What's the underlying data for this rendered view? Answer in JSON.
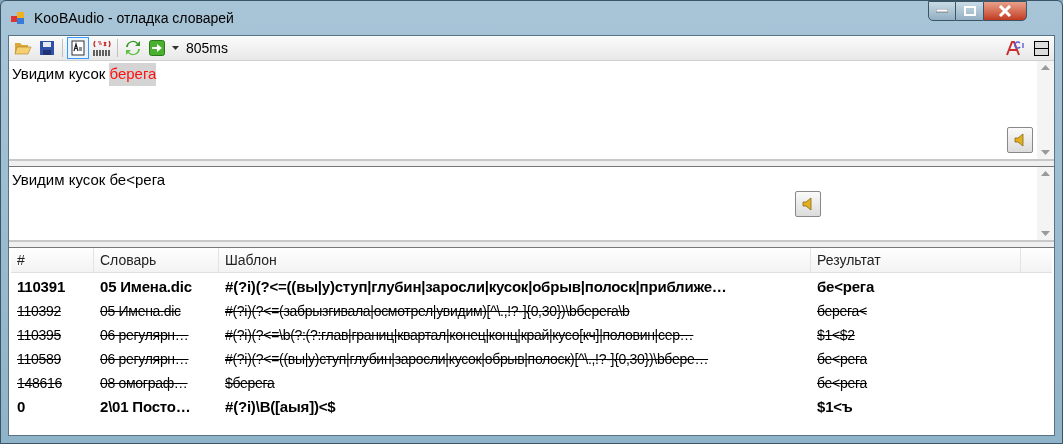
{
  "window": {
    "title": "KooBAudio - отладка словарей"
  },
  "toolbar": {
    "buttons": [
      {
        "kind": "open",
        "selected": false
      },
      {
        "kind": "save",
        "selected": false
      },
      {
        "kind": "text-mode",
        "selected": true
      },
      {
        "kind": "regex",
        "selected": false
      },
      {
        "kind": "refresh",
        "selected": false
      },
      {
        "kind": "go",
        "selected": false
      }
    ],
    "timing": "805ms"
  },
  "source": {
    "text": "Увидим кусок ",
    "highlight": "берега"
  },
  "result": {
    "text": "Увидим кусок бе<рега"
  },
  "table": {
    "columns": [
      "#",
      "Словарь",
      "Шаблон",
      "Результат"
    ],
    "rows": [
      {
        "cells": [
          "110391",
          "05 Имена.dic",
          "#(?i)(?<=((вы|у)ступ|глубин|заросли|кусок|обрыв|полоск|приближе…",
          "бе<рега"
        ],
        "applied": true
      },
      {
        "cells": [
          "110392",
          "05 Имена.dic",
          "#(?i)(?<=(забрызгивала|осмотрел|увидим)[^\\.,!?-]{0,30})\\bберега\\b",
          "берега<"
        ],
        "applied": false
      },
      {
        "cells": [
          "110395",
          "06 регулярн…",
          "#(?i)(?<=\\b(?:(?:глав|границ|квартал|конец|конц|край|кусо[кч]|половин|сер…",
          "$1<$2"
        ],
        "applied": false
      },
      {
        "cells": [
          "110589",
          "06 регулярн…",
          "#(?i)(?<=((вы|у)ступ|глубин|заросли|кусок|обрыв|полоск)[^\\.,!?-]{0,30})\\bберe…",
          "бе<рега"
        ],
        "applied": false
      },
      {
        "cells": [
          "148616",
          "08 омограф…",
          "$берега",
          "бе<рега"
        ],
        "applied": false
      },
      {
        "cells": [
          "0",
          "2\\01 Посто…",
          "#(?i)\\B([аыя])<$",
          "$1<ъ"
        ],
        "applied": true
      }
    ]
  }
}
